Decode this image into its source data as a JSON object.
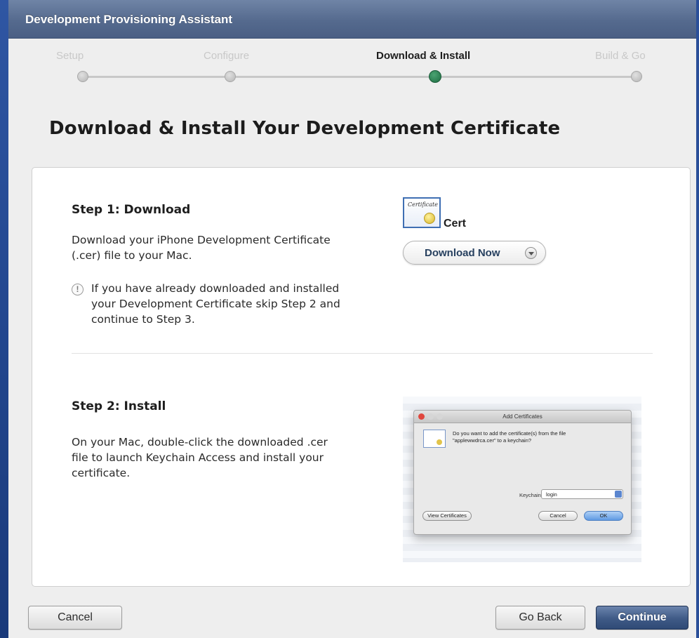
{
  "window": {
    "title": "Development Provisioning Assistant"
  },
  "progress": {
    "steps": [
      {
        "label": "Setup",
        "active": false
      },
      {
        "label": "Configure",
        "active": false
      },
      {
        "label": "Download & Install",
        "active": true
      },
      {
        "label": "Build & Go",
        "active": false
      }
    ]
  },
  "page": {
    "heading": "Download & Install Your Development Certificate"
  },
  "step1": {
    "title": "Step 1: Download",
    "description_line1": "Download your iPhone Development Certificate",
    "description_line2": "(.cer) file to your Mac.",
    "note_icon": "!",
    "note_line1": "If you have already downloaded and installed",
    "note_line2": "your Development Certificate skip Step 2 and",
    "note_line3": "continue to Step 3.",
    "cert_script": "Certificate",
    "cert_label": "Cert",
    "download_button": "Download Now"
  },
  "step2": {
    "title": "Step 2: Install",
    "description_line1": "On your Mac, double-click the downloaded .cer",
    "description_line2": "file to launch Keychain Access and install your",
    "description_line3": "certificate.",
    "dialog": {
      "title": "Add Certificates",
      "message_line1": "Do you want to add the certificate(s) from the file",
      "message_line2": "\"applewwdrca.cer\" to a keychain?",
      "keychain_label": "Keychain:",
      "keychain_value": "login",
      "view_button": "View Certificates",
      "cancel_button": "Cancel",
      "ok_button": "OK"
    }
  },
  "footer": {
    "cancel": "Cancel",
    "go_back": "Go Back",
    "continue": "Continue"
  },
  "colors": {
    "active_step": "#2a8553",
    "titlebar": "#556a8e",
    "primary_button": "#3f5a86"
  }
}
